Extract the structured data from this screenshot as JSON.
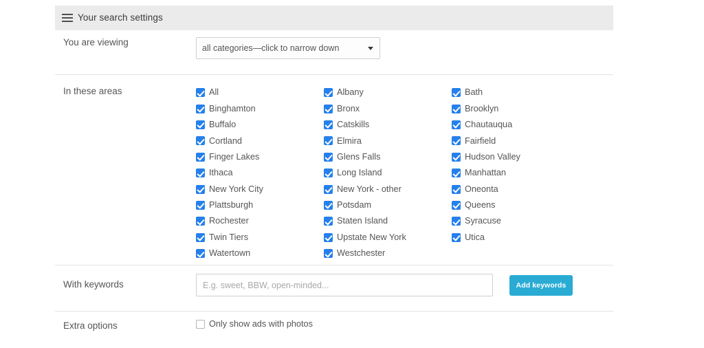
{
  "header": {
    "title": "Your search settings",
    "menu_icon": "hamburger-icon"
  },
  "rows": {
    "viewing": {
      "label": "You are viewing",
      "select_value": "all categories—click to narrow down"
    },
    "areas": {
      "label": "In these areas",
      "columns": [
        [
          {
            "label": "All",
            "checked": true
          },
          {
            "label": "Binghamton",
            "checked": true
          },
          {
            "label": "Buffalo",
            "checked": true
          },
          {
            "label": "Cortland",
            "checked": true
          },
          {
            "label": "Finger Lakes",
            "checked": true
          },
          {
            "label": "Ithaca",
            "checked": true
          },
          {
            "label": "New York City",
            "checked": true
          },
          {
            "label": "Plattsburgh",
            "checked": true
          },
          {
            "label": "Rochester",
            "checked": true
          },
          {
            "label": "Twin Tiers",
            "checked": true
          },
          {
            "label": "Watertown",
            "checked": true
          }
        ],
        [
          {
            "label": "Albany",
            "checked": true
          },
          {
            "label": "Bronx",
            "checked": true
          },
          {
            "label": "Catskills",
            "checked": true
          },
          {
            "label": "Elmira",
            "checked": true
          },
          {
            "label": "Glens Falls",
            "checked": true
          },
          {
            "label": "Long Island",
            "checked": true
          },
          {
            "label": "New York - other",
            "checked": true
          },
          {
            "label": "Potsdam",
            "checked": true
          },
          {
            "label": "Staten Island",
            "checked": true
          },
          {
            "label": "Upstate New York",
            "checked": true
          },
          {
            "label": "Westchester",
            "checked": true
          }
        ],
        [
          {
            "label": "Bath",
            "checked": true
          },
          {
            "label": "Brooklyn",
            "checked": true
          },
          {
            "label": "Chautauqua",
            "checked": true
          },
          {
            "label": "Fairfield",
            "checked": true
          },
          {
            "label": "Hudson Valley",
            "checked": true
          },
          {
            "label": "Manhattan",
            "checked": true
          },
          {
            "label": "Oneonta",
            "checked": true
          },
          {
            "label": "Queens",
            "checked": true
          },
          {
            "label": "Syracuse",
            "checked": true
          },
          {
            "label": "Utica",
            "checked": true
          }
        ]
      ]
    },
    "keywords": {
      "label": "With keywords",
      "input_value": "",
      "placeholder": "E.g. sweet, BBW, open-minded...",
      "button_label": "Add keywords"
    },
    "extra": {
      "label": "Extra options",
      "option_label": "Only show ads with photos",
      "option_checked": false
    }
  },
  "colors": {
    "checkbox_blue": "#2680eb",
    "button_teal": "#29abd4",
    "header_gray": "#ebebeb",
    "text_gray": "#555555",
    "divider": "#e3e3e3"
  }
}
